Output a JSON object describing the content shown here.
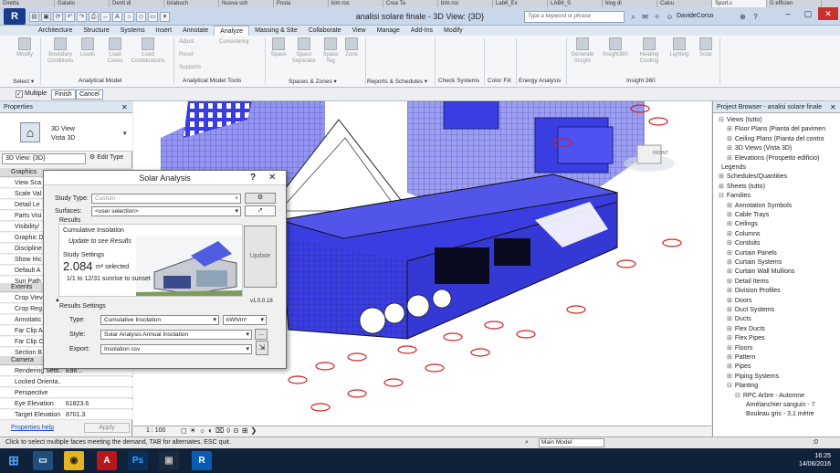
{
  "browser_tabs": [
    "Diretta",
    "Galatio",
    "Denti di",
    "birabuch",
    "Nuova sch",
    "Posta",
    "bim.roc",
    "Crea Ta",
    "bim.roc",
    "Lab6_Ex",
    "LAB6_S",
    "blog di",
    "Calcu",
    "Sport.c",
    "G efficien"
  ],
  "title_bar": {
    "app_icon": "R",
    "document_title": "analisi solare finale - 3D View: {3D}",
    "search_placeholder": "Type a keyword or phrase",
    "user_name": "DavideCorso"
  },
  "ribbon_tabs": [
    "Architecture",
    "Structure",
    "Systems",
    "Insert",
    "Annotate",
    "Analyze",
    "Massing & Site",
    "Collaborate",
    "View",
    "Manage",
    "Add-Ins",
    "Modify"
  ],
  "ribbon_active_tab": "Analyze",
  "ribbon": {
    "buttons": [
      "Modify",
      "Boundary Conditions",
      "Loads",
      "Load Cases",
      "Load Combinations",
      "Space",
      "Space Separator",
      "Space Tag",
      "Zone",
      "Generate Insight",
      "Insight360",
      "Heating Cooling",
      "Lighting",
      "Solar"
    ],
    "small": [
      "Adjust",
      "Consistency",
      "Reset",
      "Supports"
    ],
    "panels": [
      "Select ▾",
      "Analytical Model",
      "Analytical Model Tools",
      "Spaces & Zones ▾",
      "Reports & Schedules ▾",
      "Check Systems",
      "Color Fill",
      "Energy Analysis",
      "Insight 360"
    ]
  },
  "options_bar": {
    "multiple": "Multiple",
    "finish": "Finish",
    "cancel": "Cancel"
  },
  "properties": {
    "title": "Properties",
    "type_name": "3D View",
    "type_sub": "Vista 3D",
    "type_selector": "3D View: {3D}",
    "edit_type": "Edit Type",
    "sections": {
      "graphics": "Graphics",
      "extents": "Extents",
      "camera": "Camera"
    },
    "graphics_rows": [
      "View Sca",
      "Scale Val",
      "Detail Le",
      "Parts Visi",
      "Visibility/",
      "Graphic D",
      "Discipline",
      "Show Hic",
      "Default A",
      "Sun Path"
    ],
    "extents_rows": [
      "Crop Viev",
      "Crop Reg",
      "Annotatic",
      "Far Clip A",
      "Far Clip C",
      "Section B"
    ],
    "camera_rows": [
      {
        "k": "Rendering Setti...",
        "v": "Edit..."
      },
      {
        "k": "Locked Orienta...",
        "v": ""
      },
      {
        "k": "Perspective",
        "v": ""
      },
      {
        "k": "Eye Elevation",
        "v": "61823.6"
      },
      {
        "k": "Target Elevation",
        "v": "8701.3"
      }
    ],
    "help": "Properties help",
    "apply": "Apply"
  },
  "dialog": {
    "title": "Solar Analysis",
    "help_icon": "?",
    "close_icon": "✕",
    "study_type_label": "Study Type:",
    "study_type_value": "Custom",
    "surfaces_label": "Surfaces:",
    "surfaces_value": "<user selection>",
    "results_header": "Results",
    "result_title": "Cumulative Insolation",
    "update_hint": "Update to see Results",
    "study_settings": "Study Settings",
    "area_value": "2.084",
    "area_unit": "m² selected",
    "date_range": "1/1 to 12/31 sunrise to sunset",
    "update_button": "Update",
    "version": "v1.0.0.18",
    "results_settings": "Results Settings",
    "type_label": "Type:",
    "type_value": "Cumulative Insolation",
    "unit_value": "kWh/m²",
    "style_label": "Style:",
    "style_value": "Solar Analysis Annual Insolation",
    "style_more": "...",
    "export_label": "Export:",
    "export_value": "Insolation csv"
  },
  "project_browser": {
    "title": "Project Browser - analisi solare finale",
    "items": [
      {
        "t": "Views (tutto)",
        "l": 0,
        "s": "⊟"
      },
      {
        "t": "Floor Plans (Pianta del pavimen",
        "l": 1,
        "s": "⊞"
      },
      {
        "t": "Ceiling Plans (Pianta del contro",
        "l": 1,
        "s": "⊞"
      },
      {
        "t": "3D Views (Vista 3D)",
        "l": 1,
        "s": "⊞"
      },
      {
        "t": "Elevations (Prospetto edificio)",
        "l": 1,
        "s": "⊞"
      },
      {
        "t": "Legends",
        "l": 0,
        "s": ""
      },
      {
        "t": "Schedules/Quantities",
        "l": 0,
        "s": "⊞"
      },
      {
        "t": "Sheets (tutto)",
        "l": 0,
        "s": "⊞"
      },
      {
        "t": "Families",
        "l": 0,
        "s": "⊟"
      },
      {
        "t": "Annotation Symbols",
        "l": 1,
        "s": "⊞"
      },
      {
        "t": "Cable Trays",
        "l": 1,
        "s": "⊞"
      },
      {
        "t": "Ceilings",
        "l": 1,
        "s": "⊞"
      },
      {
        "t": "Columns",
        "l": 1,
        "s": "⊞"
      },
      {
        "t": "Conduits",
        "l": 1,
        "s": "⊞"
      },
      {
        "t": "Curtain Panels",
        "l": 1,
        "s": "⊞"
      },
      {
        "t": "Curtain Systems",
        "l": 1,
        "s": "⊞"
      },
      {
        "t": "Curtain Wall Mullions",
        "l": 1,
        "s": "⊞"
      },
      {
        "t": "Detail Items",
        "l": 1,
        "s": "⊞"
      },
      {
        "t": "Division Profiles",
        "l": 1,
        "s": "⊞"
      },
      {
        "t": "Doors",
        "l": 1,
        "s": "⊞"
      },
      {
        "t": "Duct Systems",
        "l": 1,
        "s": "⊞"
      },
      {
        "t": "Ducts",
        "l": 1,
        "s": "⊞"
      },
      {
        "t": "Flex Ducts",
        "l": 1,
        "s": "⊞"
      },
      {
        "t": "Flex Pipes",
        "l": 1,
        "s": "⊞"
      },
      {
        "t": "Floors",
        "l": 1,
        "s": "⊞"
      },
      {
        "t": "Pattern",
        "l": 1,
        "s": "⊞"
      },
      {
        "t": "Pipes",
        "l": 1,
        "s": "⊞"
      },
      {
        "t": "Piping Systems",
        "l": 1,
        "s": "⊞"
      },
      {
        "t": "Planting",
        "l": 1,
        "s": "⊟"
      },
      {
        "t": "RPC Arbre - Automne",
        "l": 2,
        "s": "⊟"
      },
      {
        "t": "Amélanchier sanguin - 7",
        "l": 3,
        "s": ""
      },
      {
        "t": "Bouleau gris - 3,1 mètre",
        "l": 3,
        "s": ""
      }
    ]
  },
  "view_control": {
    "scale": "1 : 100"
  },
  "status_bar": {
    "message": "Click to select multiple faces meeting the demand, TAB for alternates, ESC quit.",
    "model": "Main Model",
    "zero": ":0"
  },
  "taskbar": {
    "time": "16:25",
    "date": "14/06/2016"
  },
  "colors": {
    "building_blue": "#3a3ee0",
    "tree_red": "#d42020",
    "title_bg": "#c8d8ea"
  }
}
